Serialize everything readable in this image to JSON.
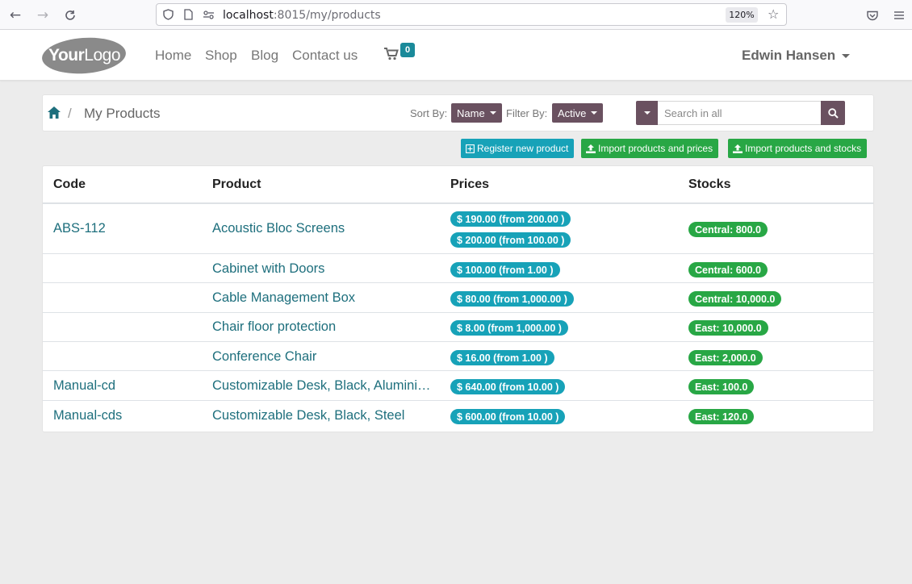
{
  "browser": {
    "url_host": "localhost",
    "url_path": ":8015/my/products",
    "zoom": "120%"
  },
  "header": {
    "logo_part1": "Your",
    "logo_part2": "Logo",
    "menu": [
      "Home",
      "Shop",
      "Blog",
      "Contact us"
    ],
    "cart_count": "0",
    "user_name": "Edwin Hansen"
  },
  "toolbar": {
    "breadcrumb_title": "My Products",
    "breadcrumb_sep": "/",
    "sort_label": "Sort By:",
    "sort_value": "Name",
    "filter_label": "Filter By:",
    "filter_value": "Active",
    "search_placeholder": "Search in all"
  },
  "actions": {
    "register": "Register new product",
    "import_prices": "Import products and prices",
    "import_stocks": "Import products and stocks"
  },
  "table": {
    "columns": [
      "Code",
      "Product",
      "Prices",
      "Stocks"
    ],
    "rows": [
      {
        "code": "ABS-112",
        "product": "Acoustic Bloc Screens",
        "prices": [
          "$ 190.00 (from 200.00 )",
          "$ 200.00 (from 100.00 )"
        ],
        "stocks": [
          "Central: 800.0"
        ]
      },
      {
        "code": "",
        "product": "Cabinet with Doors",
        "prices": [
          "$ 100.00 (from 1.00 )"
        ],
        "stocks": [
          "Central: 600.0"
        ]
      },
      {
        "code": "",
        "product": "Cable Management Box",
        "prices": [
          "$ 80.00 (from 1,000.00 )"
        ],
        "stocks": [
          "Central: 10,000.0"
        ]
      },
      {
        "code": "",
        "product": "Chair floor protection",
        "prices": [
          "$ 8.00 (from 1,000.00 )"
        ],
        "stocks": [
          "East: 10,000.0"
        ]
      },
      {
        "code": "",
        "product": "Conference Chair",
        "prices": [
          "$ 16.00 (from 1.00 )"
        ],
        "stocks": [
          "East: 2,000.0"
        ]
      },
      {
        "code": "Manual-cd",
        "product": "Customizable Desk, Black, Aluminium",
        "prices": [
          "$ 640.00 (from 10.00 )"
        ],
        "stocks": [
          "East: 100.0"
        ]
      },
      {
        "code": "Manual-cds",
        "product": "Customizable Desk, Black, Steel",
        "prices": [
          "$ 600.00 (from 10.00 )"
        ],
        "stocks": [
          "East: 120.0"
        ]
      }
    ]
  },
  "icons": {
    "back": "back-arrow-icon",
    "forward": "forward-arrow-icon",
    "reload": "reload-icon",
    "shield": "shield-icon",
    "page": "page-icon",
    "permissions": "permissions-icon",
    "bookmark": "star-icon",
    "pocket": "pocket-icon",
    "app_menu": "hamburger-menu-icon",
    "cart": "cart-icon",
    "home": "home-icon",
    "search": "search-icon",
    "add": "plus-square-icon",
    "upload": "upload-icon"
  },
  "colors": {
    "primary": "#6a5160",
    "link": "#1e6f7d",
    "info": "#17a2b8",
    "success": "#28a745",
    "badge": "#1a8a9a"
  }
}
